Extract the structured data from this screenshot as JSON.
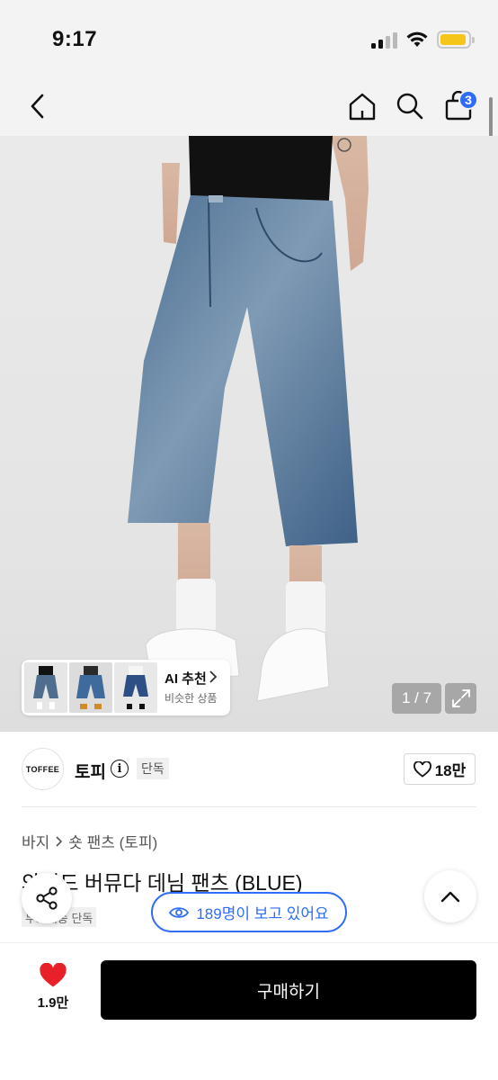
{
  "status_bar": {
    "time": "9:17"
  },
  "nav": {
    "cart_count": "3"
  },
  "gallery": {
    "counter": "1 / 7",
    "ai_recommend": {
      "title": "AI 추천",
      "subtitle": "비슷한 상품"
    }
  },
  "brand": {
    "logo_text": "TOFFEE",
    "name": "토피",
    "tag": "단독",
    "like_count": "18만"
  },
  "breadcrumb": {
    "category": "바지",
    "subcategory": "숏 팬츠 (토피)"
  },
  "product": {
    "title": "와이드 버뮤다 데님 팬츠 (BLUE)",
    "tags": "무료배송 단독"
  },
  "viewers": {
    "text": "189명이 보고 있어요"
  },
  "bottom": {
    "wish_count": "1.9만",
    "buy_label": "구매하기"
  },
  "colors": {
    "accent": "#2f6df6",
    "badge": "#2f6df6",
    "heart": "#e8202a",
    "buy_button": "#000000"
  }
}
